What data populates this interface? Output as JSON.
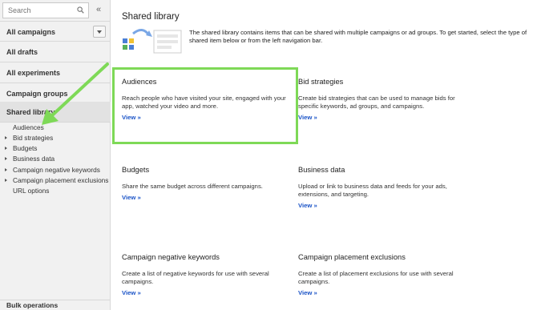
{
  "sidebar": {
    "search_placeholder": "Search",
    "collapse_glyph": "«",
    "nav": [
      {
        "label": "All campaigns"
      },
      {
        "label": "All drafts"
      },
      {
        "label": "All experiments"
      },
      {
        "label": "Campaign groups"
      },
      {
        "label": "Shared library"
      }
    ],
    "shared_library_items": [
      {
        "label": "Audiences",
        "expandable": false
      },
      {
        "label": "Bid strategies",
        "expandable": true
      },
      {
        "label": "Budgets",
        "expandable": true
      },
      {
        "label": "Business data",
        "expandable": true
      },
      {
        "label": "Campaign negative keywords",
        "expandable": true
      },
      {
        "label": "Campaign placement exclusions",
        "expandable": true
      },
      {
        "label": "URL options",
        "expandable": false
      }
    ],
    "bulk_operations": "Bulk operations"
  },
  "main": {
    "title": "Shared library",
    "intro": "The shared library contains items that can be shared with multiple campaigns or ad groups. To get started, select the type of shared item below or from the left navigation bar.",
    "cards": [
      {
        "title": "Audiences",
        "desc": "Reach people who have visited your site, engaged with your app, watched your video and more.",
        "link": "View »"
      },
      {
        "title": "Bid strategies",
        "desc": "Create bid strategies that can be used to manage bids for specific keywords, ad groups, and campaigns.",
        "link": "View »"
      },
      {
        "title": "Budgets",
        "desc": "Share the same budget across different campaigns.",
        "link": "View »"
      },
      {
        "title": "Business data",
        "desc": "Upload or link to business data and feeds for your ads, extensions, and targeting.",
        "link": "View »"
      },
      {
        "title": "Campaign negative keywords",
        "desc": "Create a list of negative keywords for use with several campaigns.",
        "link": "View »"
      },
      {
        "title": "Campaign placement exclusions",
        "desc": "Create a list of placement exclusions for use with several campaigns.",
        "link": "View »"
      }
    ]
  },
  "colors": {
    "highlight": "#7ed957",
    "link": "#1a53c7",
    "sidebar_bg": "#f1f1f1"
  },
  "icons": {
    "search": "search-icon",
    "collapse": "double-chevron-left-icon",
    "dropdown": "chevron-down-icon",
    "expand": "triangle-right-icon",
    "illustration": "shared-library-illustration-icon",
    "arrow": "callout-arrow-icon"
  }
}
